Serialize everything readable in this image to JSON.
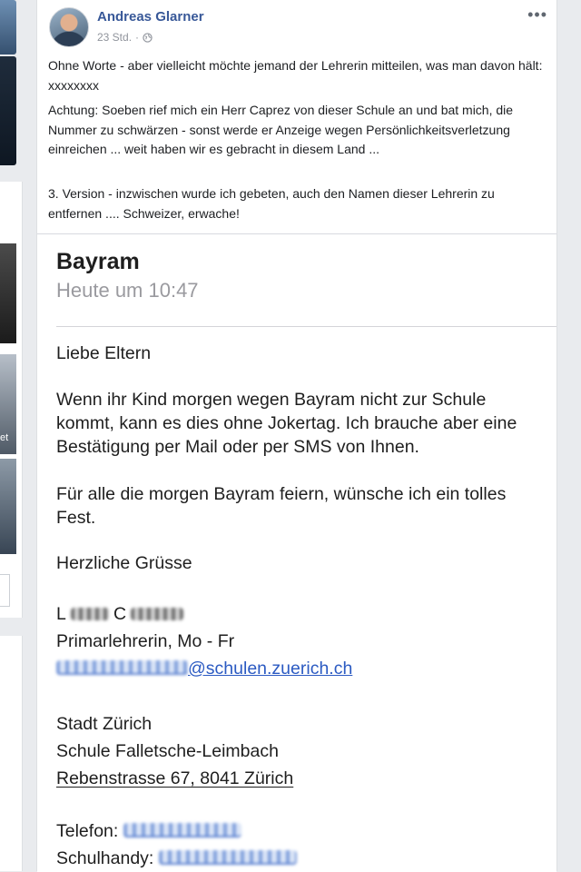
{
  "post": {
    "author": "Andreas Glarner",
    "time": "23 Std.",
    "separator": "·",
    "more_label": "•••",
    "paragraphs": [
      "Ohne Worte - aber vielleicht möchte jemand der Lehrerin mitteilen, was man davon hält: xxxxxxxx",
      "Achtung: Soeben rief mich ein Herr Caprez von dieser Schule an und bat mich, die Nummer zu schwärzen - sonst werde er Anzeige wegen Persönlichkeitsverletzung einreichen ... weit haben wir es gebracht in diesem Land ...",
      "3. Version - inzwischen wurde ich gebeten, auch den Namen dieser Lehrerin zu entfernen .... Schweizer, erwache!"
    ]
  },
  "left_column": {
    "partial_text": "et"
  },
  "message": {
    "sender": "Bayram",
    "time": "Heute um 10:47",
    "greeting": "Liebe Eltern",
    "body1": [
      "Wenn ihr Kind morgen wegen Bayram nicht zur Schule",
      "kommt, kann es dies ohne Jokertag. Ich brauche aber eine",
      "Bestätigung per Mail oder per SMS von Ihnen."
    ],
    "body2": [
      "Für alle die morgen Bayram feiern, wünsche ich ein tolles",
      "Fest."
    ],
    "closing": "Herzliche Grüsse",
    "name_initials": [
      "L",
      "C"
    ],
    "role": "Primarlehrerin, Mo - Fr",
    "email_visible": "@schulen.zuerich.ch",
    "city": "Stadt Zürich",
    "school": "Schule Falletsche-Leimbach",
    "address": "Rebenstrasse 67, 8041 Zürich",
    "phone_label": "Telefon:",
    "mobile_label": "Schulhandy:",
    "colors": {
      "link": "#2b5ac2",
      "author": "#385898",
      "muted": "#9a9a9f"
    }
  }
}
